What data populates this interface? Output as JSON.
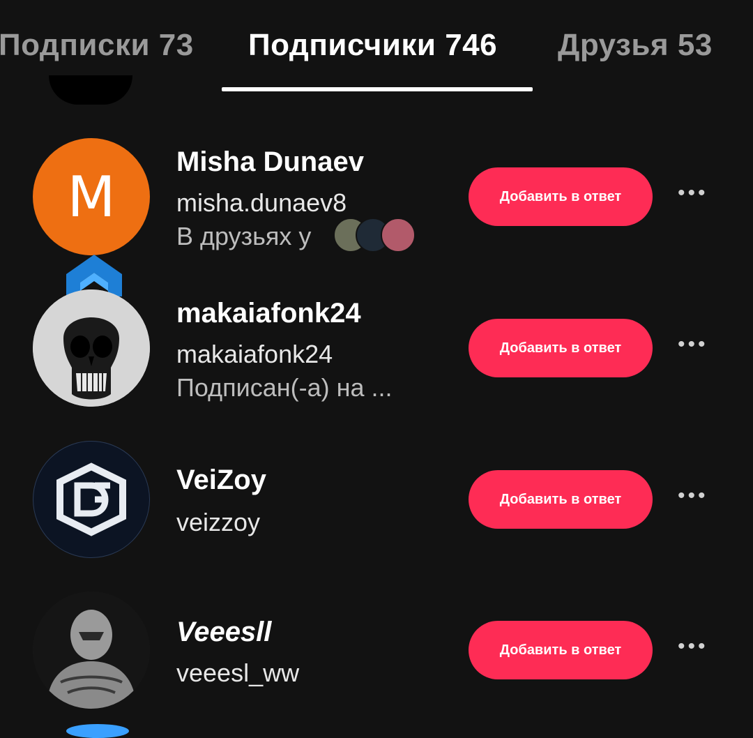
{
  "tabs": {
    "following": "Подписки 73",
    "followers": "Подписчики 746",
    "friends": "Друзья 53"
  },
  "users": [
    {
      "avatar_letter": "M",
      "avatar_color": "#ee6f12",
      "name": "Misha Dunaev",
      "handle": "misha.dunaev8",
      "subtitle": "В друзьях у",
      "button": "Добавить в ответ",
      "more": "•••"
    },
    {
      "avatar_icon": "skull-avatar-icon",
      "name": "makaiafonk24",
      "handle": "makaiafonk24",
      "subtitle": "Подписан(-а) на ...",
      "button": "Добавить в ответ",
      "more": "•••"
    },
    {
      "avatar_icon": "df-logo-avatar-icon",
      "name": "VeiZoy",
      "handle": "veizzoy",
      "button": "Добавить в ответ",
      "more": "•••"
    },
    {
      "avatar_icon": "masked-figure-avatar-icon",
      "name": "Veeesll",
      "handle": "veeesl_ww",
      "button": "Добавить в ответ",
      "more": "•••"
    }
  ],
  "colors": {
    "background": "#121212",
    "accent_button": "#fe2c55",
    "tab_inactive": "#9a9a9a"
  }
}
